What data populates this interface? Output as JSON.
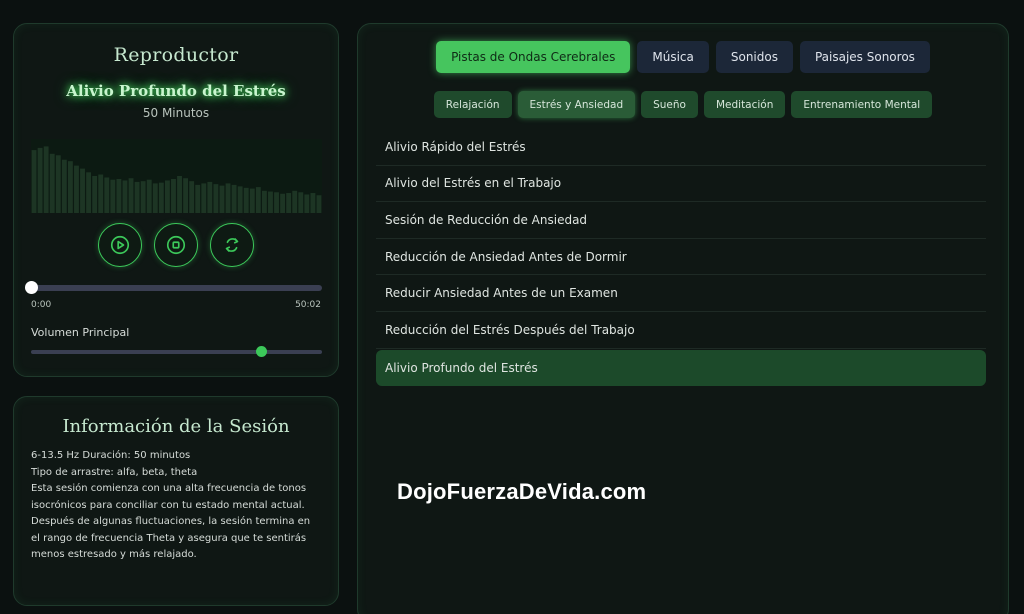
{
  "player": {
    "title": "Reproductor",
    "track_title": "Alivio Profundo del Estrés",
    "track_duration": "50 Minutos",
    "waveform_levels": [
      0.85,
      0.88,
      0.9,
      0.8,
      0.78,
      0.72,
      0.7,
      0.64,
      0.6,
      0.55,
      0.5,
      0.52,
      0.48,
      0.45,
      0.46,
      0.44,
      0.47,
      0.42,
      0.43,
      0.45,
      0.4,
      0.41,
      0.44,
      0.46,
      0.5,
      0.47,
      0.43,
      0.38,
      0.4,
      0.42,
      0.39,
      0.37,
      0.4,
      0.38,
      0.36,
      0.34,
      0.33,
      0.35,
      0.3,
      0.29,
      0.28,
      0.26,
      0.27,
      0.3,
      0.28,
      0.25,
      0.27,
      0.24
    ],
    "controls": [
      {
        "name": "play-button",
        "icon": "play-circle-icon"
      },
      {
        "name": "stop-button",
        "icon": "stop-circle-icon"
      },
      {
        "name": "loop-button",
        "icon": "repeat-icon"
      }
    ],
    "progress": 0.0,
    "time_current": "0:00",
    "time_total": "50:02",
    "volume_label": "Volumen Principal",
    "volume": 0.79
  },
  "session": {
    "title": "Información de la Sesión",
    "lines": [
      "6-13.5 Hz Duración: 50 minutos",
      "Tipo de arrastre: alfa, beta, theta",
      "Esta sesión comienza con una alta frecuencia de tonos isocrónicos para conciliar con tu estado mental actual. Después de algunas fluctuaciones, la sesión termina en el rango de frecuencia Theta y asegura que te sentirás menos estresado y más relajado."
    ]
  },
  "library": {
    "categories": [
      {
        "label": "Pistas de Ondas Cerebrales",
        "active": true
      },
      {
        "label": "Música",
        "active": false
      },
      {
        "label": "Sonidos",
        "active": false
      },
      {
        "label": "Paisajes Sonoros",
        "active": false
      }
    ],
    "subcategories": [
      {
        "label": "Relajación",
        "active": false
      },
      {
        "label": "Estrés y Ansiedad",
        "active": true
      },
      {
        "label": "Sueño",
        "active": false
      },
      {
        "label": "Meditación",
        "active": false
      },
      {
        "label": "Entrenamiento Mental",
        "active": false
      }
    ],
    "tracks": [
      {
        "label": "Alivio Rápido del Estrés",
        "selected": false
      },
      {
        "label": "Alivio del Estrés en el Trabajo",
        "selected": false
      },
      {
        "label": "Sesión de Reducción de Ansiedad",
        "selected": false
      },
      {
        "label": "Reducción de Ansiedad Antes de Dormir",
        "selected": false
      },
      {
        "label": "Reducir Ansiedad Antes de un Examen",
        "selected": false
      },
      {
        "label": "Reducción del Estrés Después del Trabajo",
        "selected": false
      },
      {
        "label": "Alivio Profundo del Estrés",
        "selected": true
      }
    ]
  },
  "watermark": "DojoFuerzaDeVida.com",
  "colors": {
    "accent": "#46c55e",
    "panel": "#0f1714",
    "background": "#0b1110"
  }
}
